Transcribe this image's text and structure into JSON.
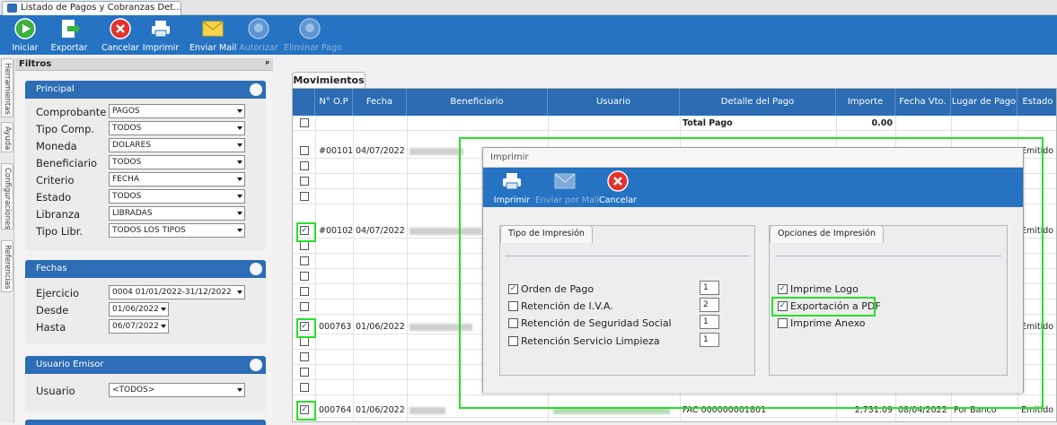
{
  "window_tab": {
    "title": "Listado de Pagos y Cobranzas Det..."
  },
  "toolbar": {
    "buttons": [
      {
        "label": "Iniciar",
        "icon": "play-icon",
        "enabled": true
      },
      {
        "label": "Exportar",
        "icon": "export-icon",
        "enabled": true
      },
      {
        "label": "Cancelar",
        "icon": "cancel-icon",
        "enabled": true
      },
      {
        "label": "Imprimir",
        "icon": "printer-icon",
        "enabled": true
      },
      {
        "label": "Enviar Mail",
        "icon": "mail-icon",
        "enabled": true
      },
      {
        "label": "Autorizar",
        "icon": "authorize-icon",
        "enabled": false
      },
      {
        "label": "Eliminar Pago",
        "icon": "delete-payment-icon",
        "enabled": false
      }
    ]
  },
  "side_tabs": [
    "Herramientas",
    "Ayuda",
    "Configuraciones",
    "Referencias"
  ],
  "filters": {
    "title": "Filtros",
    "pin": "ᵖ",
    "principal": {
      "title": "Principal",
      "rows": [
        {
          "label": "Comprobante",
          "value": "PAGOS"
        },
        {
          "label": "Tipo Comp.",
          "value": "TODOS"
        },
        {
          "label": "Moneda",
          "value": "DOLARES"
        },
        {
          "label": "Beneficiario",
          "value": "TODOS"
        },
        {
          "label": "Criterio",
          "value": "FECHA"
        },
        {
          "label": "Estado",
          "value": "TODOS"
        },
        {
          "label": "Libranza",
          "value": "LIBRADAS"
        },
        {
          "label": "Tipo Libr.",
          "value": "TODOS LOS TIPOS"
        }
      ]
    },
    "fechas": {
      "title": "Fechas",
      "rows": [
        {
          "label": "Ejercicio",
          "value": "0004 01/01/2022-31/12/2022"
        },
        {
          "label": "Desde",
          "value": "01/06/2022"
        },
        {
          "label": "Hasta",
          "value": "06/07/2022"
        }
      ]
    },
    "usuario_emisor": {
      "title": "Usuario Emisor",
      "rows": [
        {
          "label": "Usuario",
          "value": "<TODOS>"
        }
      ]
    }
  },
  "movimientos": {
    "tab_label": "Movimientos",
    "columns": [
      "N° O.P",
      "Fecha",
      "Beneficiario",
      "Usuario",
      "Detalle del Pago",
      "Importe",
      "Fecha Vto.",
      "Lugar de Pago",
      "Estado"
    ],
    "total_label": "Total Pago",
    "total_value": "0.00",
    "rows": [
      {
        "op": "#00101",
        "fecha": "04/07/2022",
        "estado": "Emitido",
        "checked": false
      },
      {
        "op": "#00102",
        "fecha": "04/07/2022",
        "estado": "Emitido",
        "checked": true
      },
      {
        "op": "000763",
        "fecha": "01/06/2022",
        "estado": "Emitido",
        "checked": true
      },
      {
        "op": "000764",
        "fecha": "01/06/2022",
        "estado": "Emitido",
        "checked": true
      }
    ],
    "last_row_detail": {
      "detalle": "FAC 000000001801",
      "importe": "2,731.09",
      "fecha_vto": "08/04/2022",
      "lugar": "Por Banco"
    }
  },
  "print_dialog": {
    "title": "Imprimir",
    "buttons": [
      {
        "label": "Imprimir",
        "icon": "printer-icon",
        "enabled": true
      },
      {
        "label": "Enviar por Mail",
        "icon": "mail-icon",
        "enabled": false
      },
      {
        "label": "Cancelar",
        "icon": "cancel-icon",
        "enabled": true
      }
    ],
    "tipo": {
      "title": "Tipo de Impresión",
      "options": [
        {
          "label": "Orden de Pago",
          "checked": true,
          "copies": "1"
        },
        {
          "label": "Retención de I.V.A.",
          "checked": false,
          "copies": "2"
        },
        {
          "label": "Retención de Seguridad Social",
          "checked": false,
          "copies": "1"
        },
        {
          "label": "Retención Servicio Limpieza",
          "checked": false,
          "copies": "1"
        }
      ]
    },
    "opciones": {
      "title": "Opciones de Impresión",
      "options": [
        {
          "label": "Imprime Logo",
          "checked": true
        },
        {
          "label": "Exportación a PDF",
          "checked": true
        },
        {
          "label": "Imprime Anexo",
          "checked": false
        }
      ]
    }
  },
  "colors": {
    "accent": "#2573c2",
    "header": "#2b6cb3",
    "highlight": "#28e028"
  }
}
